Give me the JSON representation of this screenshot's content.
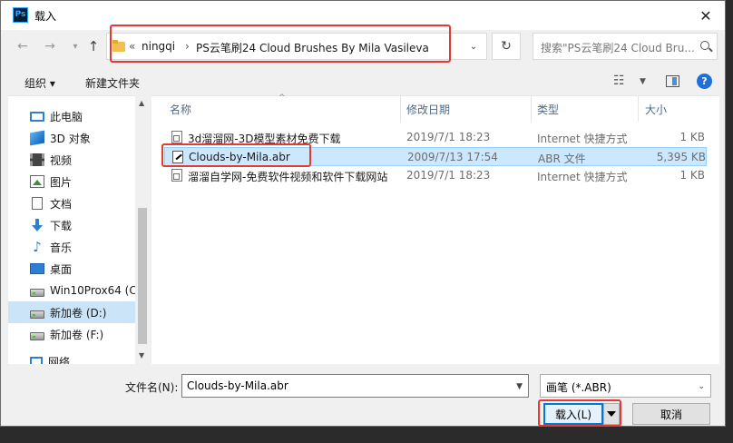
{
  "window": {
    "app_icon_text": "Ps",
    "title": "载入",
    "close_glyph": "✕"
  },
  "address": {
    "prefix_glyph": "«",
    "crumbs": [
      "ningqi",
      "PS云笔刷24 Cloud Brushes By Mila Vasileva"
    ],
    "separator": "›",
    "search_placeholder": "搜索\"PS云笔刷24 Cloud Bru..."
  },
  "toolbar": {
    "organize": "组织 ▾",
    "new_folder": "新建文件夹"
  },
  "sidebar": {
    "items": [
      {
        "label": "此电脑",
        "icon": "computer-icon"
      },
      {
        "label": "3D 对象",
        "icon": "3d-objects-icon"
      },
      {
        "label": "视频",
        "icon": "video-icon"
      },
      {
        "label": "图片",
        "icon": "pictures-icon"
      },
      {
        "label": "文档",
        "icon": "documents-icon"
      },
      {
        "label": "下载",
        "icon": "downloads-icon"
      },
      {
        "label": "音乐",
        "icon": "music-icon"
      },
      {
        "label": "桌面",
        "icon": "desktop-icon"
      },
      {
        "label": "Win10Prox64 (C",
        "icon": "drive-icon"
      },
      {
        "label": "新加卷 (D:)",
        "icon": "drive-icon"
      },
      {
        "label": "新加卷 (F:)",
        "icon": "drive-icon"
      },
      {
        "label": "网络",
        "icon": "network-icon"
      }
    ],
    "selected_index": 9
  },
  "file_list": {
    "columns": [
      "名称",
      "修改日期",
      "类型",
      "大小"
    ],
    "rows": [
      {
        "name": "3d溜溜网-3D模型素材免费下载",
        "date": "2019/7/1 18:23",
        "type": "Internet 快捷方式",
        "size": "1 KB"
      },
      {
        "name": "Clouds-by-Mila.abr",
        "date": "2009/7/13 17:54",
        "type": "ABR 文件",
        "size": "5,395 KB"
      },
      {
        "name": "溜溜自学网-免费软件视频和软件下载网站",
        "date": "2019/7/1 18:23",
        "type": "Internet 快捷方式",
        "size": "1 KB"
      }
    ],
    "selected_index": 1
  },
  "bottom": {
    "filename_label": "文件名(N):",
    "filename_value": "Clouds-by-Mila.abr",
    "filetype_value": "画笔 (*.ABR)",
    "load_label": "载入(L)",
    "cancel_label": "取消"
  },
  "colors": {
    "highlight_box": "#e53935",
    "selection": "#cce8ff",
    "accent": "#0078d7"
  }
}
